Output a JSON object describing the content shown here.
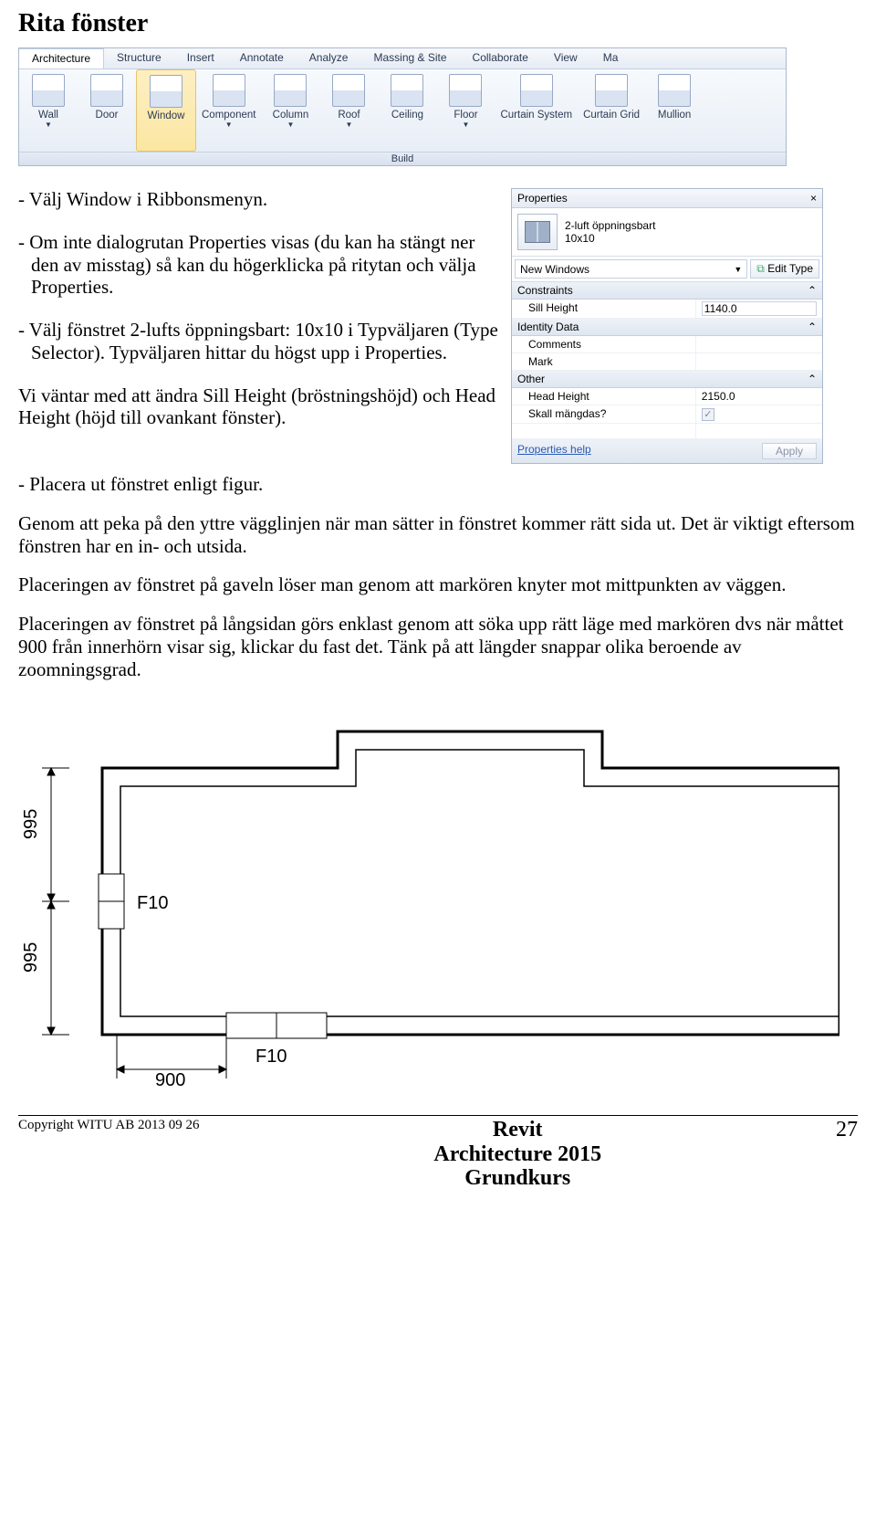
{
  "heading": "Rita fönster",
  "ribbon": {
    "tabs": [
      "Architecture",
      "Structure",
      "Insert",
      "Annotate",
      "Analyze",
      "Massing & Site",
      "Collaborate",
      "View",
      "Ma"
    ],
    "active_tab": 0,
    "buttons": [
      {
        "label": "Wall",
        "arrow": true
      },
      {
        "label": "Door"
      },
      {
        "label": "Window",
        "selected": true
      },
      {
        "label": "Component",
        "arrow": true
      },
      {
        "label": "Column",
        "arrow": true
      },
      {
        "label": "Roof",
        "arrow": true
      },
      {
        "label": "Ceiling"
      },
      {
        "label": "Floor",
        "arrow": true
      },
      {
        "label": "Curtain System"
      },
      {
        "label": "Curtain Grid"
      },
      {
        "label": "Mullion"
      }
    ],
    "group_label": "Build"
  },
  "body": {
    "p1": "- Välj Window i Ribbonsmenyn.",
    "p2": "- Om inte dialogrutan Properties visas (du kan ha stängt ner den av misstag) så kan du högerklicka på ritytan och välja Properties.",
    "p3": "- Välj fönstret 2-lufts öppningsbart: 10x10 i Typväljaren (Type Selector). Typväljaren hittar du högst upp i Properties.",
    "p4": "Vi väntar med att ändra Sill Height (bröstningshöjd) och Head Height (höjd till ovankant fönster).",
    "p5": "- Placera ut fönstret enligt figur.",
    "p6": "Genom att peka på den yttre vägglinjen när man sätter in fönstret kommer rätt sida ut. Det är viktigt eftersom fönstren har en in- och utsida.",
    "p7": "Placeringen av fönstret på gaveln löser man genom att markören knyter mot mittpunkten av väggen.",
    "p8": "Placeringen av fönstret på långsidan görs enklast genom att söka upp rätt läge med markören dvs när måttet 900 från innerhörn visar sig, klickar du fast det. Tänk på att längder snappar olika beroende av zoomningsgrad."
  },
  "props": {
    "title": "Properties",
    "type_family": "2-luft öppningsbart",
    "type_size": "10x10",
    "selector": "New Windows",
    "edit_type": "Edit Type",
    "sections": {
      "constraints": {
        "label": "Constraints",
        "rows": [
          {
            "k": "Sill Height",
            "v": "1140.0",
            "editable": true
          }
        ]
      },
      "identity": {
        "label": "Identity Data",
        "rows": [
          {
            "k": "Comments",
            "v": ""
          },
          {
            "k": "Mark",
            "v": ""
          }
        ]
      },
      "other": {
        "label": "Other",
        "rows": [
          {
            "k": "Head Height",
            "v": "2150.0"
          },
          {
            "k": "Skall mängdas?",
            "v": "",
            "check": true
          }
        ]
      }
    },
    "help": "Properties help",
    "apply": "Apply"
  },
  "plan": {
    "dim_top": "995",
    "dim_bot": "995",
    "dim_hor": "900",
    "win_label": "F10"
  },
  "footer": {
    "left": "Copyright WITU AB 2013 09 26",
    "mid1": "Revit",
    "mid2": "Architecture 2015",
    "mid3": "Grundkurs",
    "page": "27"
  }
}
